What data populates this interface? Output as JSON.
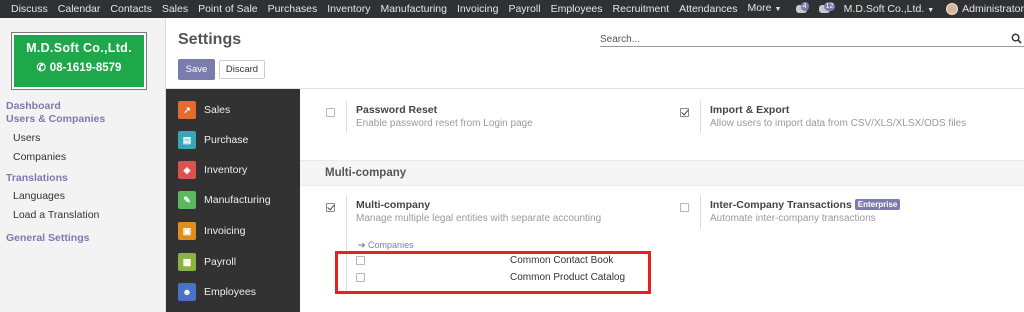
{
  "top_menu": {
    "items": [
      "Discuss",
      "Calendar",
      "Contacts",
      "Sales",
      "Point of Sale",
      "Purchases",
      "Inventory",
      "Manufacturing",
      "Invoicing",
      "Payroll",
      "Employees",
      "Recruitment",
      "Attendances"
    ],
    "more_label": "More",
    "notification_counts": {
      "activities": "4",
      "messages": "12"
    },
    "company_name": "M.D.Soft Co.,Ltd.",
    "user_name": "Administrator"
  },
  "logo": {
    "company": "M.D.Soft Co.,Ltd.",
    "phone": "08-1619-8579"
  },
  "sidebar": {
    "dashboard": "Dashboard",
    "users_companies": "Users & Companies",
    "users": "Users",
    "companies": "Companies",
    "translations": "Translations",
    "languages": "Languages",
    "load_translation": "Load a Translation",
    "general_settings": "General Settings"
  },
  "header": {
    "title": "Settings",
    "search_placeholder": "Search...",
    "save_label": "Save",
    "discard_label": "Discard"
  },
  "apps": [
    {
      "label": "Sales",
      "icon": "sales-icon",
      "color": "#e46b2c"
    },
    {
      "label": "Purchase",
      "icon": "purchase-icon",
      "color": "#38a5b8"
    },
    {
      "label": "Inventory",
      "icon": "inventory-icon",
      "color": "#d9534f"
    },
    {
      "label": "Manufacturing",
      "icon": "manufacturing-icon",
      "color": "#5cb85c"
    },
    {
      "label": "Invoicing",
      "icon": "invoicing-icon",
      "color": "#e08e1b"
    },
    {
      "label": "Payroll",
      "icon": "payroll-icon",
      "color": "#8bb341"
    },
    {
      "label": "Employees",
      "icon": "employees-icon",
      "color": "#4a72c4"
    }
  ],
  "settings": {
    "password_reset": {
      "title": "Password Reset",
      "desc": "Enable password reset from Login page",
      "checked": false
    },
    "import_export": {
      "title": "Import & Export",
      "desc": "Allow users to import data from CSV/XLS/XLSX/ODS files",
      "checked": true
    },
    "section_title": "Multi-company",
    "multi_company": {
      "title": "Multi-company",
      "desc": "Manage multiple legal entities with separate accounting",
      "checked": true,
      "link": "Companies"
    },
    "inter_company": {
      "title": "Inter-Company Transactions",
      "badge": "Enterprise",
      "desc": "Automate inter-company transactions",
      "checked": false
    },
    "common_contact_book": {
      "label": "Common Contact Book",
      "checked": false
    },
    "common_product_catalog": {
      "label": "Common Product Catalog",
      "checked": false
    }
  }
}
